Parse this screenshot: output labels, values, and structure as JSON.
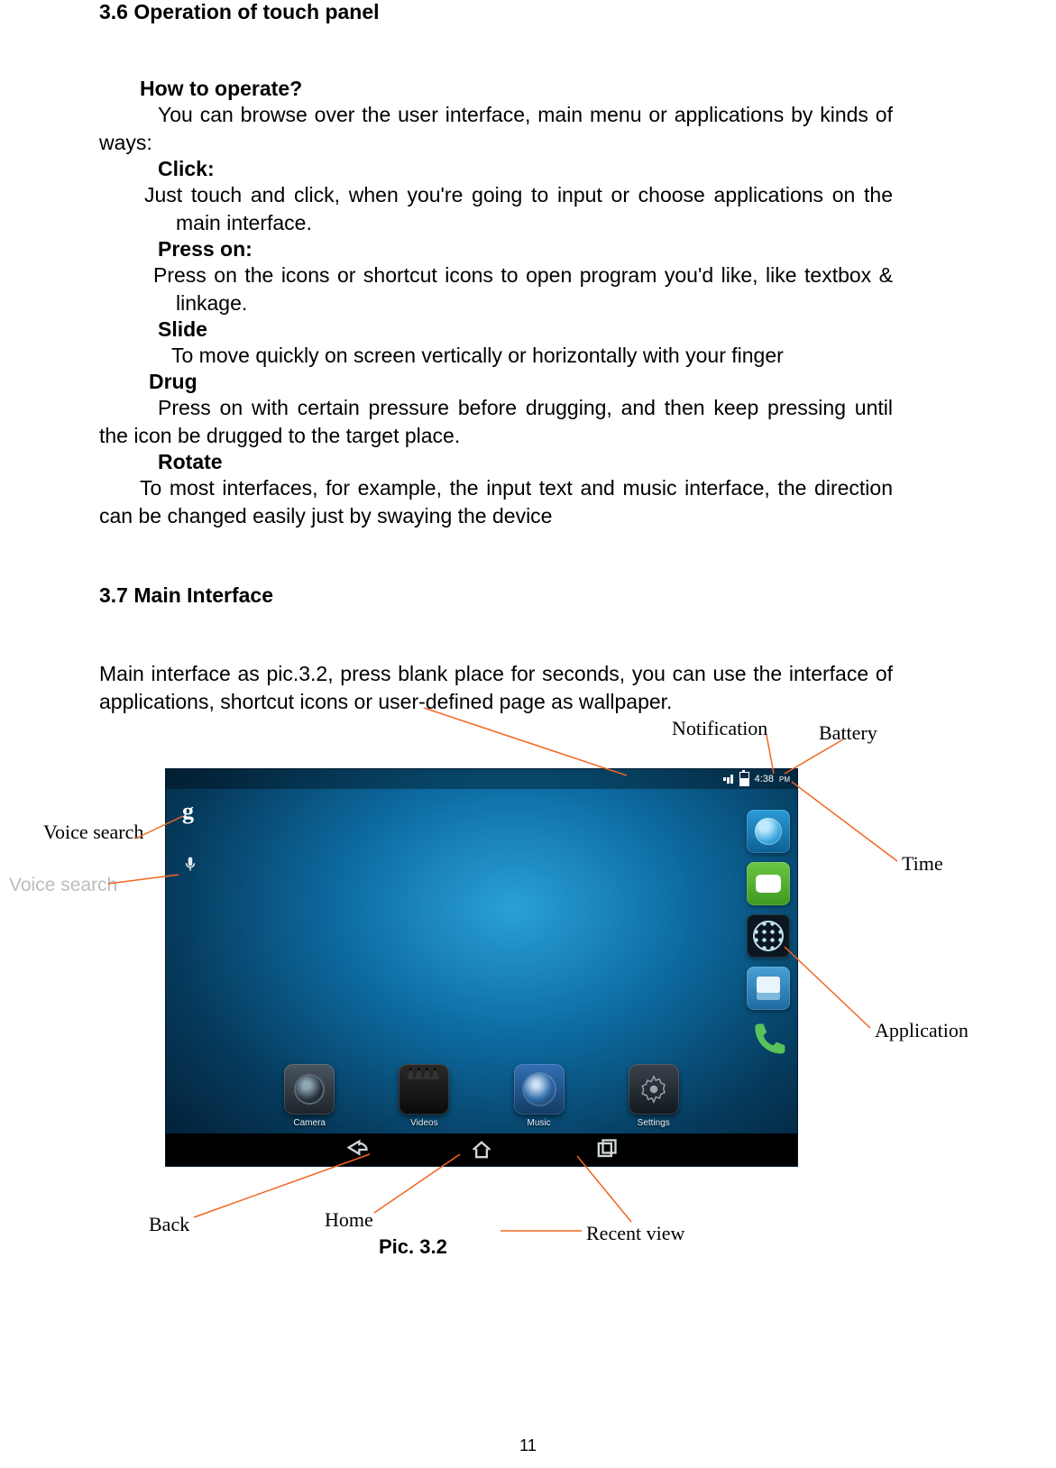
{
  "sections": {
    "s36": {
      "heading": "3.6 Operation of touch panel",
      "howto": "How to operate?",
      "intro": "You can browse over the user interface, main menu or applications by kinds of ways:",
      "click_h": "Click:",
      "click_b": "Just touch and click, when you're going to input or choose applications on the main interface.",
      "press_h": "Press on:",
      "press_b": "Press on the icons or shortcut icons to open program you'd like, like textbox & linkage.",
      "slide_h": "Slide",
      "slide_b": "To move quickly on screen vertically or horizontally with your finger",
      "drug_h": "Drug",
      "drug_b": "Press on with certain pressure before drugging, and then keep pressing until the icon be drugged to the target place.",
      "rotate_h": "Rotate",
      "rotate_b": "To most interfaces, for example, the input text and music interface,  the direction can be changed easily just by swaying the device"
    },
    "s37": {
      "heading": "3.7 Main Interface",
      "intro": "Main interface as pic.3.2, press blank place for seconds, you can use the interface of applications, shortcut icons or user-defined page as wallpaper."
    }
  },
  "annotations": {
    "voice_search_bold": "Voice search",
    "voice_search_gray": "Voice search",
    "notification": "Notification",
    "battery": "Battery",
    "time": "Time",
    "application": "Application",
    "back": "Back",
    "home": "Home",
    "recent": "Recent view"
  },
  "tablet": {
    "status_time": "4:38",
    "status_ampm": "PM",
    "dock_apps": [
      "Camera",
      "Videos",
      "Music",
      "Settings"
    ],
    "search_letter": "g"
  },
  "caption": "Pic. 3.2",
  "page_number": "11"
}
